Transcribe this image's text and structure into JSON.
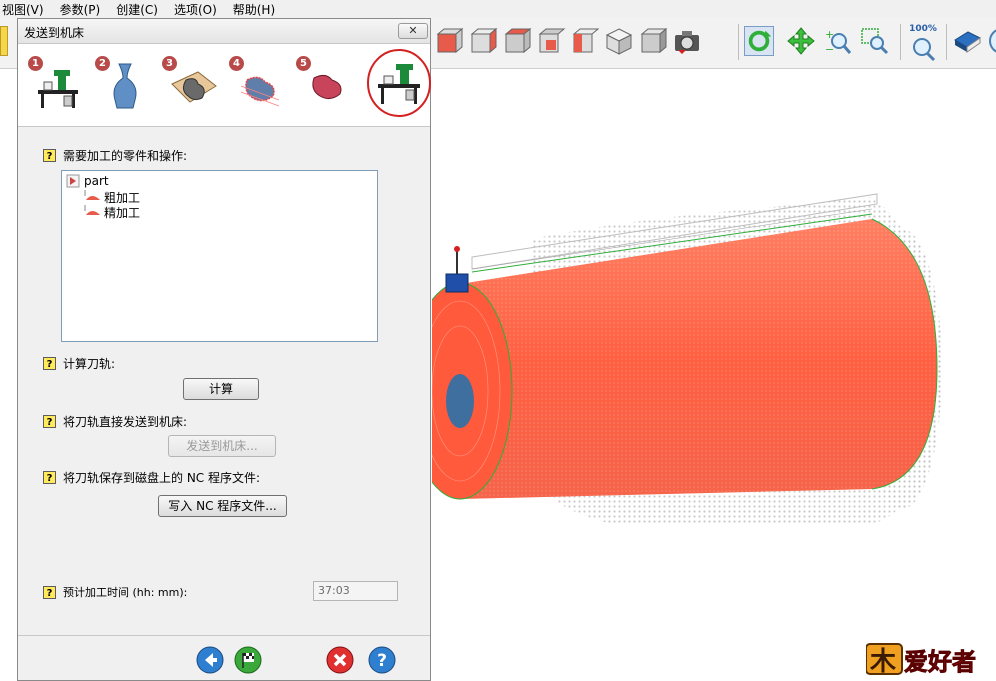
{
  "menu": [
    "视图(V)",
    "参数(P)",
    "创建(C)",
    "选项(O)",
    "帮助(H)"
  ],
  "dialog": {
    "title": "发送到机床",
    "close_label": "✕",
    "steps": [
      "1",
      "2",
      "3",
      "4",
      "5"
    ],
    "help_glyph": "?",
    "sections": {
      "parts_label": "需要加工的零件和操作:",
      "compute_label": "计算刀轨:",
      "compute_button": "计算",
      "send_label": "将刀轨直接发送到机床:",
      "send_button": "发送到机床...",
      "save_label": "将刀轨保存到磁盘上的 NC 程序文件:",
      "save_button": "写入 NC 程序文件...",
      "time_label": "预计加工时间 (hh: mm):",
      "time_value": "37:03"
    },
    "tree": {
      "root": "part",
      "children": [
        "粗加工",
        "精加工"
      ]
    }
  },
  "toolbar_zoom_label": "100%",
  "logo_text": "爱好者",
  "colors": {
    "accent_red": "#d42020",
    "toolpath_red": "#ff5a3c",
    "step_badge": "#b84a4a",
    "help_yellow": "#ffea5c"
  }
}
